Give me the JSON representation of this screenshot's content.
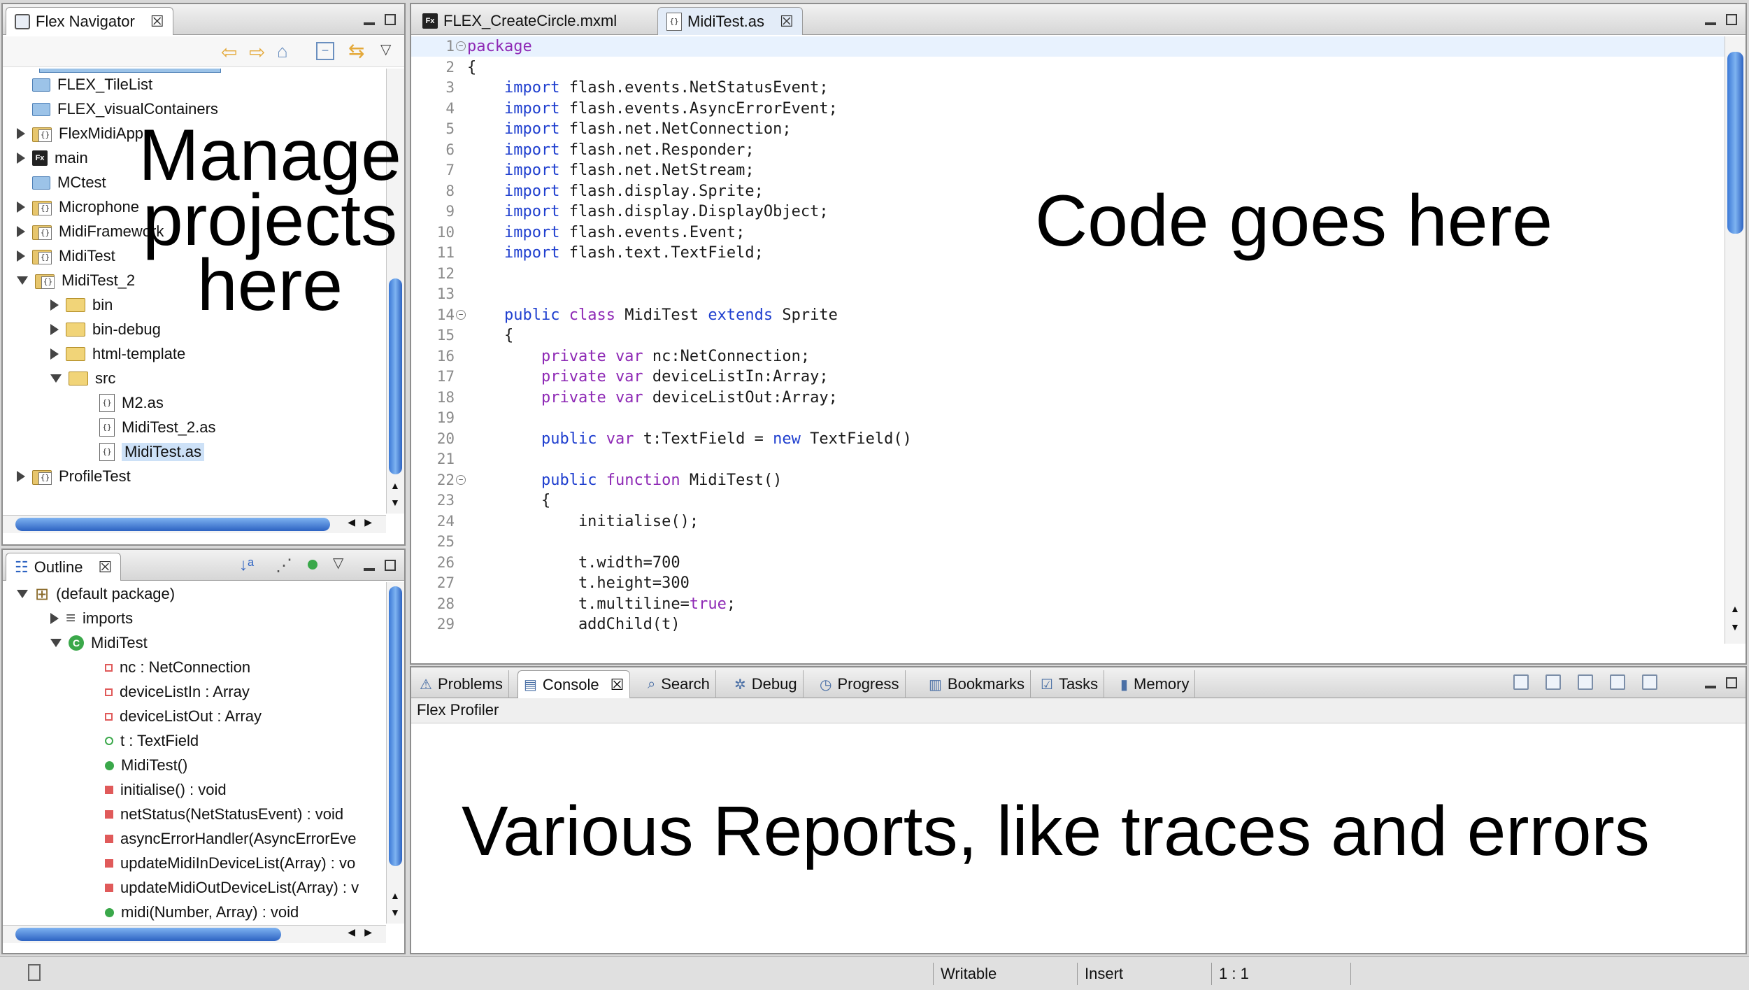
{
  "navigator": {
    "title": "Flex Navigator",
    "items": [
      {
        "label": "FLEX_TileList",
        "icon": "folder-icon",
        "depth": 0,
        "toggle": "none"
      },
      {
        "label": "FLEX_visualContainers",
        "icon": "folder-icon",
        "depth": 0,
        "toggle": "none"
      },
      {
        "label": "FlexMidiApp",
        "icon": "project-folder-icon",
        "depth": 0,
        "toggle": "collapsed"
      },
      {
        "label": "main",
        "icon": "flex-project-icon",
        "depth": 0,
        "toggle": "collapsed"
      },
      {
        "label": "MCtest",
        "icon": "folder-icon",
        "depth": 0,
        "toggle": "none"
      },
      {
        "label": "Microphone",
        "icon": "project-folder-icon",
        "depth": 0,
        "toggle": "collapsed"
      },
      {
        "label": "MidiFramework",
        "icon": "project-folder-icon",
        "depth": 0,
        "toggle": "collapsed"
      },
      {
        "label": "MidiTest",
        "icon": "project-folder-icon",
        "depth": 0,
        "toggle": "collapsed"
      },
      {
        "label": "MidiTest_2",
        "icon": "project-folder-icon",
        "depth": 0,
        "toggle": "expanded"
      },
      {
        "label": "bin",
        "icon": "open-folder-icon",
        "depth": 1,
        "toggle": "collapsed"
      },
      {
        "label": "bin-debug",
        "icon": "open-folder-icon",
        "depth": 1,
        "toggle": "collapsed"
      },
      {
        "label": "html-template",
        "icon": "open-folder-icon",
        "depth": 1,
        "toggle": "collapsed"
      },
      {
        "label": "src",
        "icon": "source-folder-icon",
        "depth": 1,
        "toggle": "expanded"
      },
      {
        "label": "M2.as",
        "icon": "as-file-icon",
        "depth": 2,
        "toggle": "none"
      },
      {
        "label": "MidiTest_2.as",
        "icon": "as-file-icon",
        "depth": 2,
        "toggle": "none"
      },
      {
        "label": "MidiTest.as",
        "icon": "as-file-icon",
        "depth": 2,
        "toggle": "none",
        "selected": true
      },
      {
        "label": "ProfileTest",
        "icon": "project-folder-icon",
        "depth": 0,
        "toggle": "collapsed"
      }
    ]
  },
  "outline": {
    "title": "Outline",
    "items": [
      {
        "label": "(default package)",
        "depth": 0,
        "toggle": "expanded",
        "icon": "package-icon"
      },
      {
        "label": "imports",
        "depth": 1,
        "toggle": "collapsed",
        "icon": "imports-icon"
      },
      {
        "label": "MidiTest",
        "depth": 1,
        "toggle": "expanded",
        "icon": "class-icon"
      },
      {
        "label": "nc : NetConnection",
        "depth": 2,
        "toggle": "none",
        "icon": "private-field-icon"
      },
      {
        "label": "deviceListIn : Array",
        "depth": 2,
        "toggle": "none",
        "icon": "private-field-icon"
      },
      {
        "label": "deviceListOut : Array",
        "depth": 2,
        "toggle": "none",
        "icon": "private-field-icon"
      },
      {
        "label": "t : TextField",
        "depth": 2,
        "toggle": "none",
        "icon": "public-field-icon"
      },
      {
        "label": "MidiTest()",
        "depth": 2,
        "toggle": "none",
        "icon": "public-method-icon"
      },
      {
        "label": "initialise() : void",
        "depth": 2,
        "toggle": "none",
        "icon": "private-method-icon"
      },
      {
        "label": "netStatus(NetStatusEvent) : void",
        "depth": 2,
        "toggle": "none",
        "icon": "private-method-icon"
      },
      {
        "label": "asyncErrorHandler(AsyncErrorEve",
        "depth": 2,
        "toggle": "none",
        "icon": "private-method-icon"
      },
      {
        "label": "updateMidiInDeviceList(Array) : vo",
        "depth": 2,
        "toggle": "none",
        "icon": "private-method-icon"
      },
      {
        "label": "updateMidiOutDeviceList(Array) : v",
        "depth": 2,
        "toggle": "none",
        "icon": "private-method-icon"
      },
      {
        "label": "midi(Number, Array) : void",
        "depth": 2,
        "toggle": "none",
        "icon": "public-method-icon"
      }
    ]
  },
  "editor": {
    "tabs": [
      {
        "label": "FLEX_CreateCircle.mxml",
        "active": false
      },
      {
        "label": "MidiTest.as",
        "active": true
      }
    ],
    "lines": [
      {
        "n": "1",
        "text": "package"
      },
      {
        "n": "2",
        "text": "{"
      },
      {
        "n": "3",
        "text": "    import flash.events.NetStatusEvent;"
      },
      {
        "n": "4",
        "text": "    import flash.events.AsyncErrorEvent;"
      },
      {
        "n": "5",
        "text": "    import flash.net.NetConnection;"
      },
      {
        "n": "6",
        "text": "    import flash.net.Responder;"
      },
      {
        "n": "7",
        "text": "    import flash.net.NetStream;"
      },
      {
        "n": "8",
        "text": "    import flash.display.Sprite;"
      },
      {
        "n": "9",
        "text": "    import flash.display.DisplayObject;"
      },
      {
        "n": "10",
        "text": "    import flash.events.Event;"
      },
      {
        "n": "11",
        "text": "    import flash.text.TextField;"
      },
      {
        "n": "12",
        "text": ""
      },
      {
        "n": "13",
        "text": ""
      },
      {
        "n": "14",
        "text": "    public class MidiTest extends Sprite"
      },
      {
        "n": "15",
        "text": "    {"
      },
      {
        "n": "16",
        "text": "        private var nc:NetConnection;"
      },
      {
        "n": "17",
        "text": "        private var deviceListIn:Array;"
      },
      {
        "n": "18",
        "text": "        private var deviceListOut:Array;"
      },
      {
        "n": "19",
        "text": ""
      },
      {
        "n": "20",
        "text": "        public var t:TextField = new TextField()"
      },
      {
        "n": "21",
        "text": ""
      },
      {
        "n": "22",
        "text": "        public function MidiTest()"
      },
      {
        "n": "23",
        "text": "        {"
      },
      {
        "n": "24",
        "text": "            initialise();"
      },
      {
        "n": "25",
        "text": ""
      },
      {
        "n": "26",
        "text": "            t.width=700"
      },
      {
        "n": "27",
        "text": "            t.height=300"
      },
      {
        "n": "28",
        "text": "            t.multiline=true;"
      },
      {
        "n": "29",
        "text": "            addChild(t)"
      }
    ]
  },
  "bottom_panel": {
    "tabs": [
      "Problems",
      "Console",
      "Search",
      "Debug",
      "Progress",
      "Bookmarks",
      "Tasks",
      "Memory"
    ],
    "active_tab": "Console",
    "console_title": "Flex Profiler"
  },
  "annotations": {
    "manage_projects": [
      "Manage",
      "projects",
      "here"
    ],
    "code": "Code goes here",
    "reports": "Various Reports, like traces and errors"
  },
  "status_bar": {
    "writable": "Writable",
    "insert_mode": "Insert",
    "cursor_position": "1 : 1"
  },
  "colors": {
    "keyword": "#1f3fcf",
    "keyword_purple": "#8e29b5",
    "selection": "#cde1f7",
    "scroll_thumb": "#3c79d6"
  }
}
